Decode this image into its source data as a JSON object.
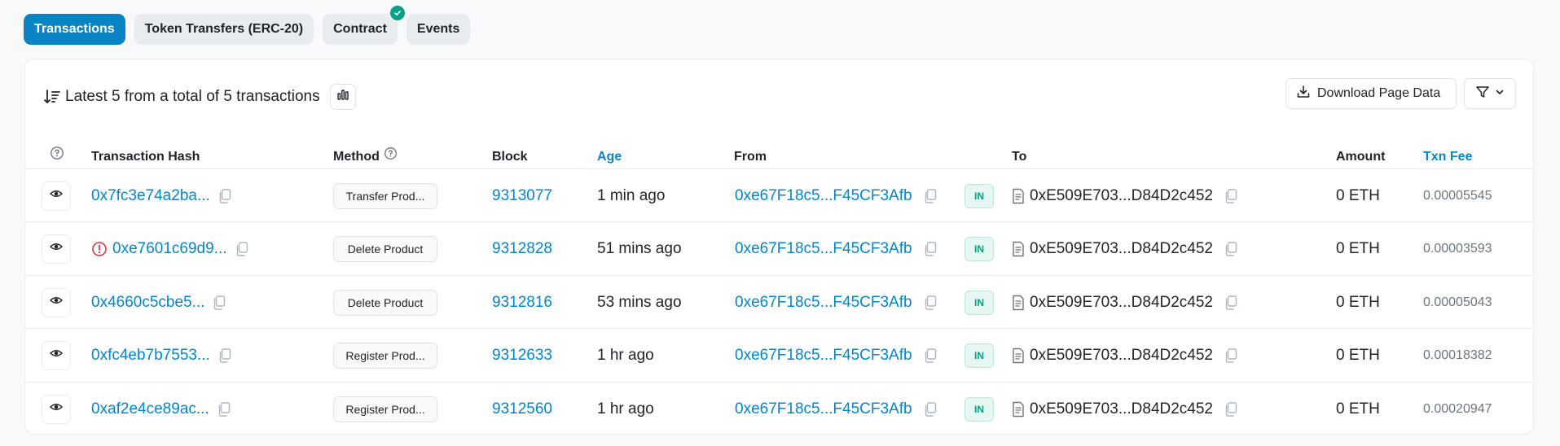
{
  "tabs": [
    {
      "label": "Transactions",
      "active": true
    },
    {
      "label": "Token Transfers (ERC-20)",
      "active": false
    },
    {
      "label": "Contract",
      "active": false,
      "verified": true
    },
    {
      "label": "Events",
      "active": false
    }
  ],
  "summary": {
    "text": "Latest 5 from a total of 5 transactions"
  },
  "toolbar": {
    "download_label": "Download Page Data"
  },
  "table": {
    "headers": {
      "transaction_hash": "Transaction Hash",
      "method": "Method",
      "block": "Block",
      "age": "Age",
      "from": "From",
      "to": "To",
      "amount": "Amount",
      "txn_fee": "Txn Fee"
    },
    "rows": [
      {
        "hash": "0x7fc3e74a2ba...",
        "error": false,
        "method": "Transfer Prod...",
        "block": "9313077",
        "age": "1 min ago",
        "from": "0xe67F18c5...F45CF3Afb",
        "direction": "IN",
        "to": "0xE509E703...D84D2c452",
        "amount": "0 ETH",
        "fee": "0.00005545"
      },
      {
        "hash": "0xe7601c69d9...",
        "error": true,
        "method": "Delete Product",
        "block": "9312828",
        "age": "51 mins ago",
        "from": "0xe67F18c5...F45CF3Afb",
        "direction": "IN",
        "to": "0xE509E703...D84D2c452",
        "amount": "0 ETH",
        "fee": "0.00003593"
      },
      {
        "hash": "0x4660c5cbe5...",
        "error": false,
        "method": "Delete Product",
        "block": "9312816",
        "age": "53 mins ago",
        "from": "0xe67F18c5...F45CF3Afb",
        "direction": "IN",
        "to": "0xE509E703...D84D2c452",
        "amount": "0 ETH",
        "fee": "0.00005043"
      },
      {
        "hash": "0xfc4eb7b7553...",
        "error": false,
        "method": "Register Prod...",
        "block": "9312633",
        "age": "1 hr ago",
        "from": "0xe67F18c5...F45CF3Afb",
        "direction": "IN",
        "to": "0xE509E703...D84D2c452",
        "amount": "0 ETH",
        "fee": "0.00018382"
      },
      {
        "hash": "0xaf2e4ce89ac...",
        "error": false,
        "method": "Register Prod...",
        "block": "9312560",
        "age": "1 hr ago",
        "from": "0xe67F18c5...F45CF3Afb",
        "direction": "IN",
        "to": "0xE509E703...D84D2c452",
        "amount": "0 ETH",
        "fee": "0.00020947"
      }
    ]
  },
  "colors": {
    "accent": "#0784c3",
    "success": "#00a186",
    "error": "#dc3545"
  }
}
